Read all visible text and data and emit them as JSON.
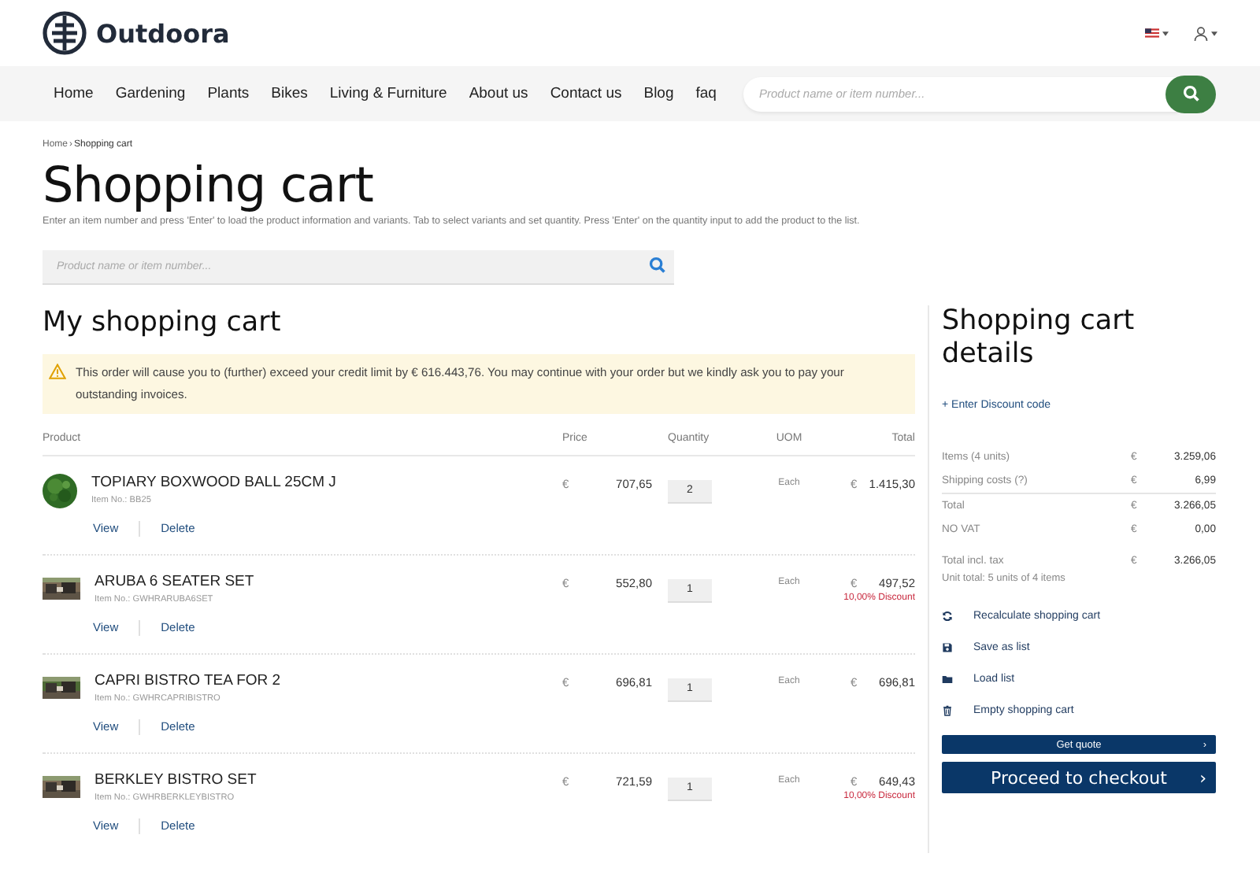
{
  "brand": {
    "name": "Outdoora"
  },
  "nav": [
    "Home",
    "Gardening",
    "Plants",
    "Bikes",
    "Living & Furniture",
    "About us",
    "Contact us",
    "Blog",
    "faq"
  ],
  "header_search": {
    "placeholder": "Product name or item number..."
  },
  "breadcrumb": {
    "items": [
      "Home",
      "Shopping cart"
    ],
    "separator": "›"
  },
  "page": {
    "title": "Shopping cart",
    "intro": "Enter an item number and press 'Enter' to load the product information and variants. Tab to select variants and set quantity. Press 'Enter' on the quantity input to add the product to the list."
  },
  "quick_add": {
    "placeholder": "Product name or item number..."
  },
  "cart": {
    "title": "My shopping cart",
    "alert": {
      "kind": "warning",
      "text": "This order will cause you to (further) exceed your credit limit by € 616.443,76. You may continue with your order but we kindly ask you to pay your outstanding invoices."
    },
    "columns": [
      "Product",
      "Price",
      "Quantity",
      "UOM",
      "Total"
    ],
    "items": [
      {
        "name": "TOPIARY BOXWOOD BALL 25CM J",
        "item_no": "Item No.: BB25",
        "currency": "€",
        "price": "707,65",
        "quantity": "2",
        "uom": "Each",
        "total_currency": "€",
        "total": "1.415,30",
        "actions": [
          "View",
          "Delete"
        ]
      },
      {
        "name": "ARUBA 6 SEATER SET",
        "item_no": "Item No.: GWHRARUBA6SET",
        "currency": "€",
        "price": "552,80",
        "quantity": "1",
        "uom": "Each",
        "total_currency": "€",
        "total": "497,52",
        "discount": "10,00% Discount",
        "actions": [
          "View",
          "Delete"
        ]
      },
      {
        "name": "CAPRI BISTRO TEA FOR 2",
        "item_no": "Item No.: GWHRCAPRIBISTRO",
        "currency": "€",
        "price": "696,81",
        "quantity": "1",
        "uom": "Each",
        "total_currency": "€",
        "total": "696,81",
        "actions": [
          "View",
          "Delete"
        ]
      },
      {
        "name": "BERKLEY BISTRO SET",
        "item_no": "Item No.: GWHRBERKLEYBISTRO",
        "currency": "€",
        "price": "721,59",
        "quantity": "1",
        "uom": "Each",
        "total_currency": "€",
        "total": "649,43",
        "discount": "10,00% Discount",
        "actions": [
          "View",
          "Delete"
        ]
      }
    ]
  },
  "summary": {
    "title": "Shopping cart details",
    "discount_link": "+ Enter Discount code",
    "rows": [
      {
        "kind": "line",
        "label": "Items (4 units)",
        "currency": "€",
        "value": "3.259,06"
      },
      {
        "kind": "line",
        "label": "Shipping costs (?)",
        "currency": "€",
        "value": "6,99"
      },
      {
        "kind": "total",
        "label": "Total",
        "currency": "€",
        "value": "3.266,05"
      },
      {
        "kind": "line",
        "label": "NO VAT",
        "currency": "€",
        "value": "0,00"
      },
      {
        "kind": "grand",
        "label": "Total incl. tax",
        "currency": "€",
        "value": "3.266,05"
      }
    ],
    "unit_total": "Unit total: 5 units of 4 items",
    "actions": [
      {
        "kind": "recalculate",
        "label": "Recalculate shopping cart"
      },
      {
        "kind": "save",
        "label": "Save as list"
      },
      {
        "kind": "load",
        "label": "Load list"
      },
      {
        "kind": "empty",
        "label": "Empty shopping cart"
      }
    ],
    "buttons": [
      {
        "kind": "small",
        "label": "Get quote",
        "chevron": "›"
      },
      {
        "kind": "large",
        "label": "Proceed to checkout",
        "chevron": "›"
      }
    ]
  }
}
